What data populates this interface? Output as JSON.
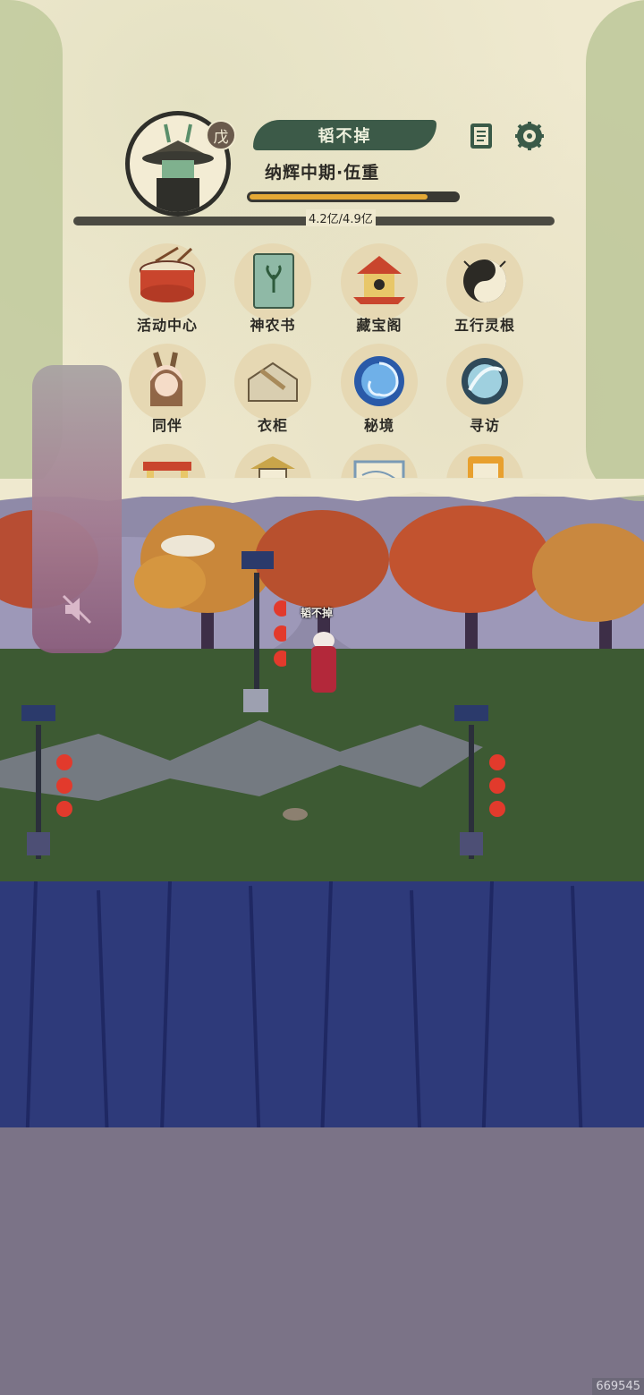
{
  "player": {
    "zodiac_badge": "戊",
    "name": "韬不掉",
    "realm": "纳辉中期·伍重",
    "xp_text": "4.2亿/4.9亿",
    "xp_progress": 0.857
  },
  "top_icons": [
    "scroll-book-icon",
    "gear-settings-icon"
  ],
  "menu": [
    {
      "label": "活动中心",
      "icon": "drum-icon"
    },
    {
      "label": "神农书",
      "icon": "herb-book-icon"
    },
    {
      "label": "藏宝阁",
      "icon": "pagoda-icon"
    },
    {
      "label": "五行灵根",
      "icon": "yin-yang-icon"
    },
    {
      "label": "同伴",
      "icon": "companion-girl-icon"
    },
    {
      "label": "衣柜",
      "icon": "folded-clothes-icon"
    },
    {
      "label": "秘境",
      "icon": "portal-vortex-icon"
    },
    {
      "label": "寻访",
      "icon": "crystal-orb-icon"
    },
    {
      "label": "",
      "icon": "gate-icon"
    },
    {
      "label": "",
      "icon": "shrine-icon"
    },
    {
      "label": "",
      "icon": "map-scroll-icon"
    },
    {
      "label": "",
      "icon": "tablet-icon"
    }
  ],
  "scene": {
    "character_name": "韬不掉"
  },
  "volume_muted": true,
  "watermark": "669545",
  "colors": {
    "paper": "#efe9cf",
    "banner": "#3c5a48",
    "xp_fill": "#e5a935",
    "cliff": "#2e3a7a"
  }
}
